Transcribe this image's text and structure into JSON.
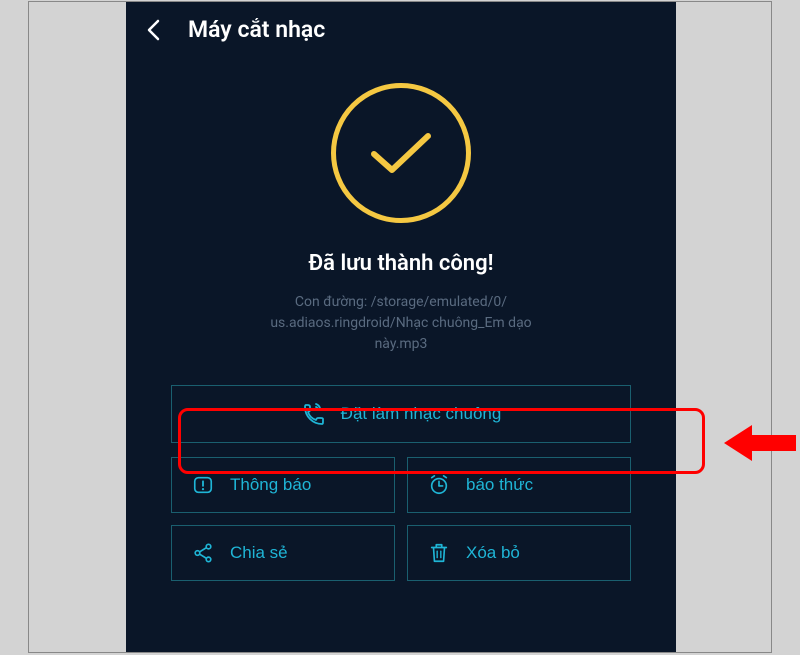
{
  "header": {
    "title": "Máy cắt nhạc"
  },
  "success": {
    "message": "Đã lưu thành công!",
    "path_prefix": "Con đường: ",
    "path_line1": "Con đường: /storage/emulated/0/",
    "path_line2": "us.adiaos.ringdroid/Nhạc chuông_Em dạo",
    "path_line3": "này.mp3"
  },
  "buttons": {
    "set_ringtone": "Đặt làm nhạc chuông",
    "notification": "Thông báo",
    "alarm": "báo thức",
    "share": "Chia sẻ",
    "delete": "Xóa bỏ"
  },
  "colors": {
    "accent": "#f5c842",
    "cyan": "#1fb5d6",
    "background": "#0a1628"
  }
}
